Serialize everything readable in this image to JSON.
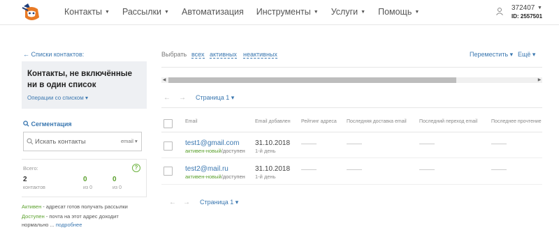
{
  "header": {
    "nav": [
      {
        "label": "Контакты",
        "dropdown": true
      },
      {
        "label": "Рассылки",
        "dropdown": true
      },
      {
        "label": "Автоматизация",
        "dropdown": false
      },
      {
        "label": "Инструменты",
        "dropdown": true
      },
      {
        "label": "Услуги",
        "dropdown": true
      },
      {
        "label": "Помощь",
        "dropdown": true
      }
    ],
    "account_number": "372407",
    "account_id": "ID: 2557501",
    "user_icon": "user-icon",
    "logo_icon": "mascot-logo-icon"
  },
  "sidebar": {
    "back_link": "← Списки контактов:",
    "list_title": "Контакты, не включённые ни в один список",
    "list_ops": "Операции со списком ▾",
    "segmentation": "Сегментация",
    "search_placeholder": "Искать контакты",
    "search_field": "email ▾",
    "stats": {
      "total_label": "Всего:",
      "items": [
        {
          "value": "2",
          "label": "контактов",
          "color": "#333333"
        },
        {
          "value": "0",
          "label": "из 0",
          "color": "#5aa02c"
        },
        {
          "value": "0",
          "label": "из 0",
          "color": "#5aa02c"
        }
      ]
    },
    "legend": {
      "active_word": "Активен",
      "active_text": " - адресат готов получать рассылки",
      "available_word": "Доступен",
      "available_text": " - почта на этот адрес доходит",
      "more_prefix": "нормально ... ",
      "more_link": "подробнее"
    }
  },
  "main": {
    "select_label": "Выбрать",
    "select_all": "всех",
    "select_active": "активных",
    "select_inactive": "неактивных",
    "move": "Переместить ▾",
    "more": "Ещё ▾",
    "pager_top": "Страница 1 ▾",
    "pager_bottom": "Страница 1 ▾",
    "columns": [
      "Email",
      "Email добавлен",
      "Рейтинг адреса",
      "Последняя доставка email",
      "Последний переход email",
      "Последнее прочтение"
    ],
    "rows": [
      {
        "email": "test1@gmail.com",
        "status_active": "активен-новый",
        "status_rest": "/доступен",
        "date": "31.10.2018",
        "day": "1-й день"
      },
      {
        "email": "test2@mail.ru",
        "status_active": "активен-новый",
        "status_rest": "/доступен",
        "date": "31.10.2018",
        "day": "1-й день"
      }
    ]
  },
  "colors": {
    "link": "#3a77b0",
    "accent_green": "#5aa02c",
    "panel_bg": "#eef0f3"
  }
}
